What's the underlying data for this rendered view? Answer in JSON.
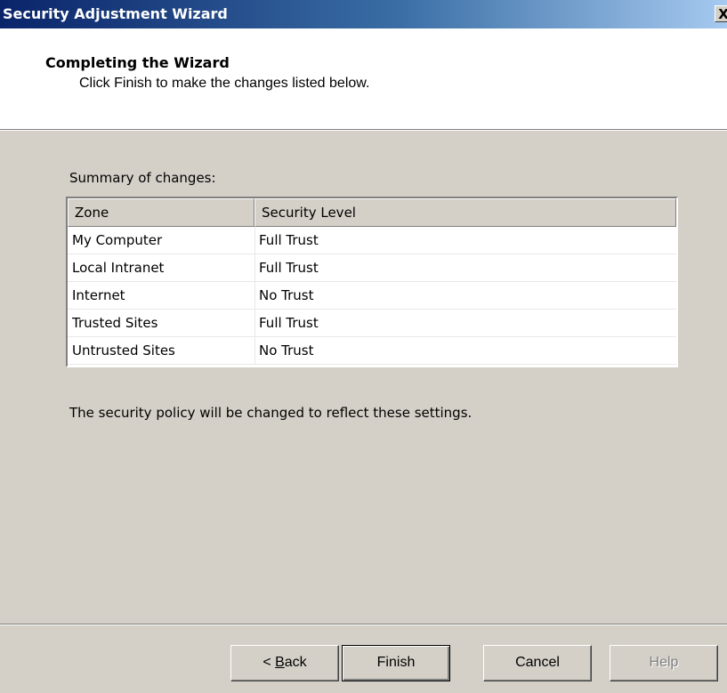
{
  "window": {
    "title": "Security Adjustment Wizard",
    "close_glyph": "X"
  },
  "header": {
    "title": "Completing the Wizard",
    "subtitle": "Click Finish to make the changes listed below."
  },
  "summary": {
    "label": "Summary of changes:",
    "columns": [
      "Zone",
      "Security Level"
    ],
    "rows": [
      {
        "zone": "My Computer",
        "level": "Full Trust"
      },
      {
        "zone": "Local Intranet",
        "level": "Full Trust"
      },
      {
        "zone": "Internet",
        "level": "No Trust"
      },
      {
        "zone": "Trusted Sites",
        "level": "Full Trust"
      },
      {
        "zone": "Untrusted Sites",
        "level": "No Trust"
      }
    ]
  },
  "note": "The security policy will be changed to reflect these settings.",
  "buttons": {
    "back_prefix": "< ",
    "back_mnemonic": "B",
    "back_rest": "ack",
    "finish": "Finish",
    "cancel": "Cancel",
    "help": "Help"
  },
  "colors": {
    "title_bar_start": "#0a246a",
    "title_bar_end": "#a6caf0",
    "dialog_face": "#d4d0c8",
    "header_bg": "#ffffff",
    "disabled_text": "#808080"
  }
}
